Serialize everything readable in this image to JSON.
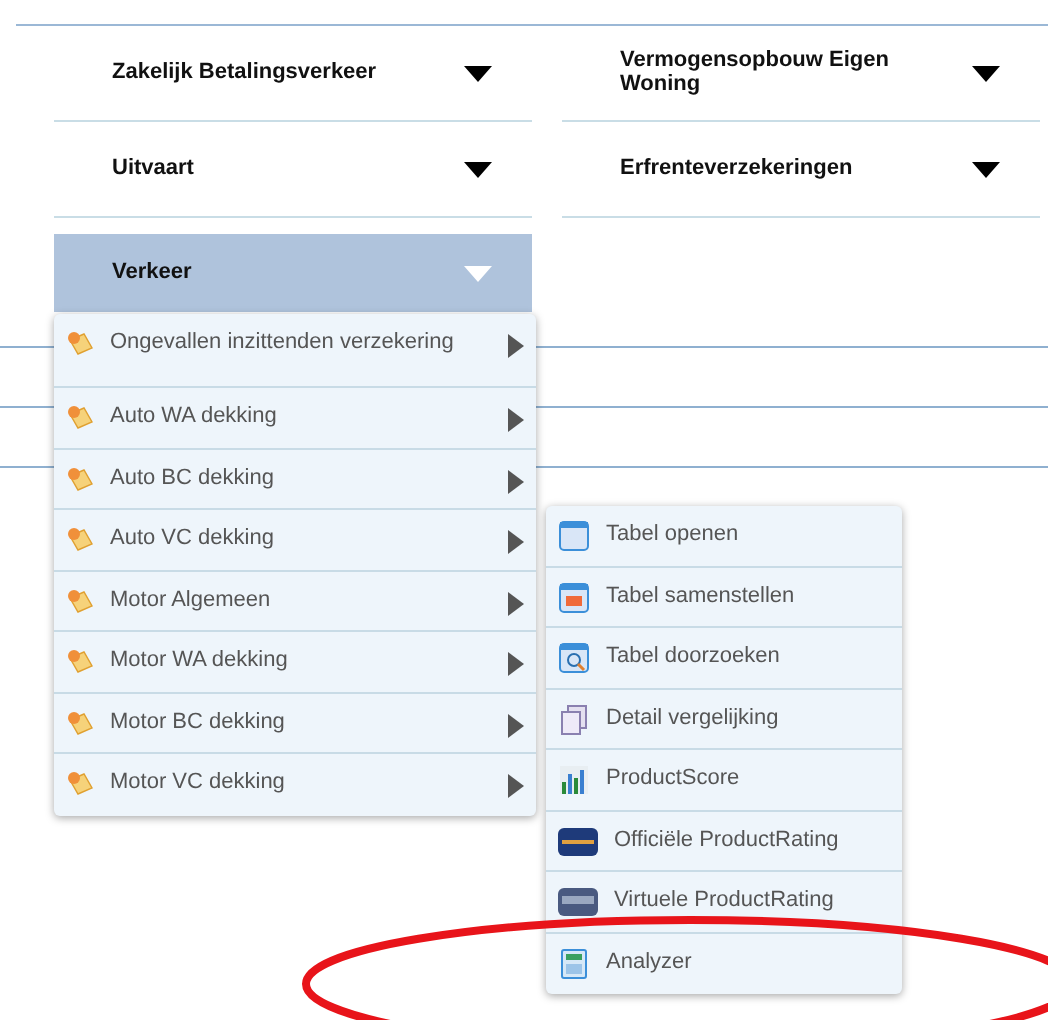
{
  "categories": [
    {
      "label": "Zakelijk Betalingsverkeer",
      "selected": false
    },
    {
      "label": "Vermogensopbouw Eigen Woning",
      "selected": false
    },
    {
      "label": "Uitvaart",
      "selected": false
    },
    {
      "label": "Erfrenteverzekeringen",
      "selected": false
    },
    {
      "label": "Verkeer",
      "selected": true
    }
  ],
  "submenu": {
    "items": [
      {
        "label": "Ongevallen inzittenden verzekering"
      },
      {
        "label": "Auto WA dekking"
      },
      {
        "label": "Auto BC dekking"
      },
      {
        "label": "Auto VC dekking"
      },
      {
        "label": "Motor Algemeen"
      },
      {
        "label": "Motor WA dekking"
      },
      {
        "label": "Motor BC dekking"
      },
      {
        "label": "Motor VC dekking"
      }
    ]
  },
  "actions": {
    "items": [
      {
        "label": "Tabel openen",
        "kind": "table"
      },
      {
        "label": "Tabel samenstellen",
        "kind": "compose"
      },
      {
        "label": "Tabel doorzoeken",
        "kind": "search"
      },
      {
        "label": "Detail vergelijking",
        "kind": "compare"
      },
      {
        "label": "ProductScore",
        "kind": "chart"
      },
      {
        "label": "Officiële ProductRating",
        "kind": "rating"
      },
      {
        "label": "Virtuele ProductRating",
        "kind": "virtual"
      },
      {
        "label": "Analyzer",
        "kind": "calculator"
      }
    ]
  }
}
